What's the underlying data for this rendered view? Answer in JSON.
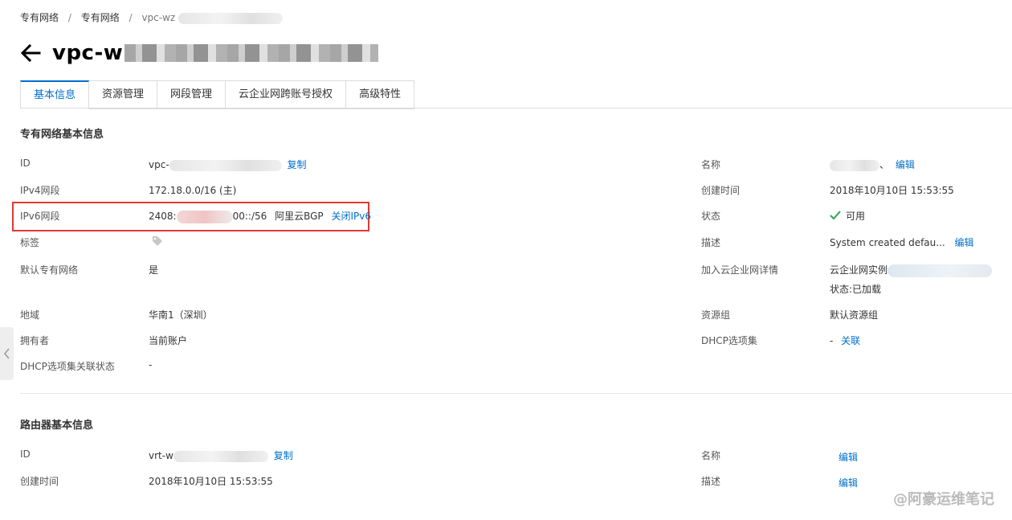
{
  "breadcrumb": {
    "item1": "专有网络",
    "item2": "专有网络",
    "current": "vpc-wz",
    "separator": "/"
  },
  "header": {
    "title_prefix": "vpc-w"
  },
  "tabs": [
    {
      "label": "基本信息",
      "active": true
    },
    {
      "label": "资源管理"
    },
    {
      "label": "网段管理"
    },
    {
      "label": "云企业网跨账号授权"
    },
    {
      "label": "高级特性"
    }
  ],
  "vpc_section": {
    "title": "专有网络基本信息",
    "left": {
      "id_label": "ID",
      "id_value": "vpc-",
      "copy": "复制",
      "ipv4_label": "IPv4网段",
      "ipv4_value": "172.18.0.0/16 (主)",
      "ipv6_label": "IPv6网段",
      "ipv6_prefix": "2408:",
      "ipv6_suffix": "00::/56",
      "ipv6_isp": "阿里云BGP",
      "ipv6_action": "关闭IPv6",
      "tag_label": "标签",
      "default_label": "默认专有网络",
      "default_value": "是",
      "region_label": "地域",
      "region_value": "华南1（深圳）",
      "owner_label": "拥有者",
      "owner_value": "当前账户",
      "dhcp_status_label": "DHCP选项集关联状态",
      "dhcp_status_value": "-"
    },
    "right": {
      "name_label": "名称",
      "name_suffix": "、",
      "edit": "编辑",
      "created_label": "创建时间",
      "created_value": "2018年10月10日 15:53:55",
      "status_label": "状态",
      "status_value": "可用",
      "desc_label": "描述",
      "desc_value": "System created defau...",
      "desc_edit": "编辑",
      "cen_label": "加入云企业网详情",
      "cen_value": "云企业网实例",
      "cen_status": "状态:已加载",
      "rg_label": "资源组",
      "rg_value": "默认资源组",
      "dhcp_label": "DHCP选项集",
      "dhcp_value": "-",
      "dhcp_action": "关联"
    }
  },
  "router_section": {
    "title": "路由器基本信息",
    "id_label": "ID",
    "id_value": "vrt-w",
    "copy": "复制",
    "created_label": "创建时间",
    "created_value": "2018年10月10日 15:53:55",
    "name_label": "名称",
    "name_edit": "编辑",
    "desc_label": "描述",
    "desc_edit": "编辑"
  },
  "watermark": "@阿豪运维笔记",
  "colors": {
    "link": "#0070cc",
    "highlight_border": "#e53935",
    "status_ok": "#2aa64b"
  }
}
